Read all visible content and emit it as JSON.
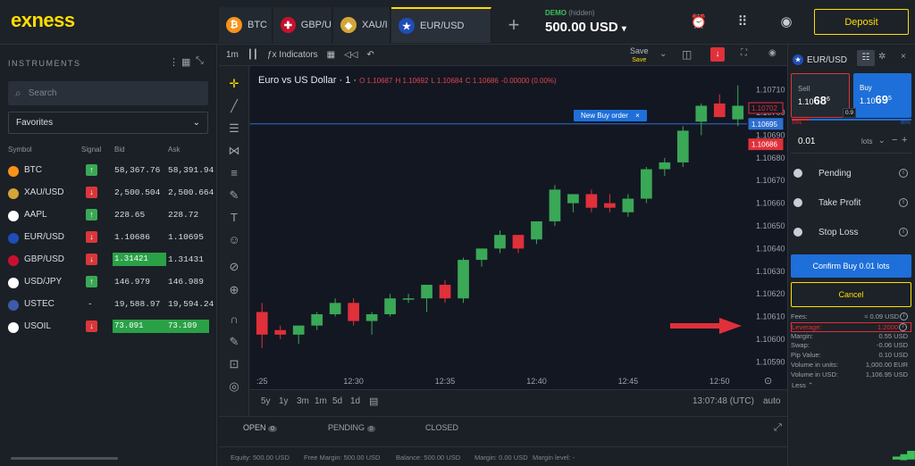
{
  "brand": {
    "logo": "exness",
    "accent": "#ffde02"
  },
  "tabs": [
    {
      "label": "BTC",
      "icon": "btc-coin-icon",
      "color": "#f7931a"
    },
    {
      "label": "GBP/U",
      "icon": "gbp-flag-icon",
      "color": "#c8102e"
    },
    {
      "label": "XAU/I",
      "icon": "gold-icon",
      "color": "#d4a537"
    },
    {
      "label": "EUR/USD",
      "icon": "eur-flag-icon",
      "color": "#1e4db7"
    }
  ],
  "account": {
    "tag": "DEMO",
    "tag_sub": "(hidden)",
    "balance": "500.00 USD"
  },
  "header": {
    "deposit": "Deposit"
  },
  "sidebar": {
    "title": "INSTRUMENTS",
    "search_placeholder": "Search",
    "favorites": "Favorites",
    "col_symbol": "Symbol",
    "col_signal": "Signal",
    "col_bid": "Bid",
    "col_ask": "Ask",
    "rows": [
      {
        "symbol": "BTC",
        "signal": "up",
        "bid": "58,367.76",
        "ask": "58,391.94",
        "icon_color": "#f7931a"
      },
      {
        "symbol": "XAU/USD",
        "signal": "down",
        "bid": "2,500.504",
        "ask": "2,500.664",
        "icon_color": "#d4a537"
      },
      {
        "symbol": "AAPL",
        "signal": "up",
        "bid": "228.65",
        "ask": "228.72",
        "icon_color": "#ffffff"
      },
      {
        "symbol": "EUR/USD",
        "signal": "down",
        "bid": "1.10686",
        "ask": "1.10695",
        "icon_color": "#1e4db7"
      },
      {
        "symbol": "GBP/USD",
        "signal": "down",
        "bid": "1.31421",
        "ask": "1.31431",
        "icon_color": "#c8102e",
        "bid_hl": true
      },
      {
        "symbol": "USD/JPY",
        "signal": "up",
        "bid": "146.979",
        "ask": "146.989",
        "icon_color": "#ffffff"
      },
      {
        "symbol": "USTEC",
        "signal": "-",
        "bid": "19,588.97",
        "ask": "19,594.24",
        "icon_color": "#3c5ba9"
      },
      {
        "symbol": "USOIL",
        "signal": "down",
        "bid": "73.091",
        "ask": "73.109",
        "icon_color": "#ffffff",
        "bid_hl": true,
        "ask_hl": true
      }
    ]
  },
  "toolbar": {
    "interval": "1m",
    "indicators": "Indicators",
    "save": "Save",
    "save_sub": "Save"
  },
  "chart_info": {
    "title": "Euro vs US Dollar · 1 ·",
    "o": "O 1.10687",
    "h": "H 1.10692",
    "l": "L 1.10684",
    "c": "C 1.10686",
    "chg": "-0.00000 (0.00%)"
  },
  "order_label": "New Buy order",
  "price_tags": {
    "sell": "1.10702",
    "line": "1.10695",
    "bid": "1.10686"
  },
  "range_buttons": [
    "5y",
    "1y",
    "3m",
    "1m",
    "5d",
    "1d"
  ],
  "chart_footer": {
    "time": "13:07:48 (UTC)",
    "mode": "auto"
  },
  "bottom_tabs": {
    "open": "OPEN",
    "open_count": "0",
    "pending": "PENDING",
    "pending_count": "0",
    "closed": "CLOSED"
  },
  "status_bar": {
    "equity": "Equity: 500.00 USD",
    "free": "Free Margin: 500.00 USD",
    "balance": "Balance: 500.00 USD",
    "margin": "Margin: 0.00 USD",
    "level": "Margin level: -"
  },
  "panel": {
    "symbol": "EUR/USD",
    "sell_label": "Sell",
    "sell_price_a": "1.10",
    "sell_price_b": "68",
    "sell_price_c": "6",
    "buy_label": "Buy",
    "buy_price_a": "1.10",
    "buy_price_b": "69",
    "buy_price_c": "5",
    "spread": "0.9",
    "pct_left": "15%",
    "pct_right": "85%",
    "lots_value": "0.01",
    "lots_unit": "lots",
    "pending": "Pending",
    "take_profit": "Take Profit",
    "stop_loss": "Stop Loss",
    "confirm": "Confirm Buy 0.01 lots",
    "cancel": "Cancel",
    "fees": [
      {
        "label": "Fees:",
        "value": "≈ 0.09 USD"
      },
      {
        "label": "Leverage:",
        "value": "1:2000"
      },
      {
        "label": "Margin:",
        "value": "0.55 USD"
      },
      {
        "label": "Swap:",
        "value": "-0.06 USD"
      },
      {
        "label": "Pip Value:",
        "value": "0.10 USD"
      },
      {
        "label": "Volume in units:",
        "value": "1,000.00 EUR"
      },
      {
        "label": "Volume in USD:",
        "value": "1,106.95 USD"
      }
    ],
    "less": "Less"
  },
  "chart_data": {
    "type": "candlestick",
    "ylim": [
      1.10585,
      1.10715
    ],
    "y_ticks": [
      "1.10710",
      "1.10700",
      "1.10690",
      "1.10680",
      "1.10670",
      "1.10660",
      "1.10650",
      "1.10640",
      "1.10630",
      "1.10620",
      "1.10610",
      "1.10600",
      "1.10590"
    ],
    "x_ticks": [
      {
        "label": ":25",
        "i": 0
      },
      {
        "label": "12:30",
        "i": 5
      },
      {
        "label": "12:35",
        "i": 10
      },
      {
        "label": "12:40",
        "i": 15
      },
      {
        "label": "12:45",
        "i": 20
      },
      {
        "label": "12:50",
        "i": 25
      }
    ],
    "candles": [
      {
        "o": 1.10612,
        "h": 1.10616,
        "l": 1.10596,
        "c": 1.10602
      },
      {
        "o": 1.10604,
        "h": 1.10606,
        "l": 1.106,
        "c": 1.10602
      },
      {
        "o": 1.10602,
        "h": 1.10606,
        "l": 1.10598,
        "c": 1.10606
      },
      {
        "o": 1.10606,
        "h": 1.10612,
        "l": 1.10604,
        "c": 1.10611
      },
      {
        "o": 1.10611,
        "h": 1.10618,
        "l": 1.1061,
        "c": 1.10616
      },
      {
        "o": 1.10616,
        "h": 1.10618,
        "l": 1.10606,
        "c": 1.10608
      },
      {
        "o": 1.10608,
        "h": 1.10612,
        "l": 1.10602,
        "c": 1.10611
      },
      {
        "o": 1.10611,
        "h": 1.1062,
        "l": 1.1061,
        "c": 1.10618
      },
      {
        "o": 1.10618,
        "h": 1.1062,
        "l": 1.10616,
        "c": 1.10618
      },
      {
        "o": 1.10618,
        "h": 1.10624,
        "l": 1.10612,
        "c": 1.10624
      },
      {
        "o": 1.10624,
        "h": 1.10626,
        "l": 1.10616,
        "c": 1.10618
      },
      {
        "o": 1.10618,
        "h": 1.10636,
        "l": 1.10616,
        "c": 1.10635
      },
      {
        "o": 1.10635,
        "h": 1.1064,
        "l": 1.10632,
        "c": 1.1064
      },
      {
        "o": 1.1064,
        "h": 1.10648,
        "l": 1.10638,
        "c": 1.10646
      },
      {
        "o": 1.10646,
        "h": 1.10644,
        "l": 1.10638,
        "c": 1.1064
      },
      {
        "o": 1.10644,
        "h": 1.10652,
        "l": 1.10642,
        "c": 1.10652
      },
      {
        "o": 1.10652,
        "h": 1.10668,
        "l": 1.1065,
        "c": 1.10666
      },
      {
        "o": 1.1066,
        "h": 1.10664,
        "l": 1.10656,
        "c": 1.10664
      },
      {
        "o": 1.10664,
        "h": 1.10666,
        "l": 1.10656,
        "c": 1.10658
      },
      {
        "o": 1.1066,
        "h": 1.10664,
        "l": 1.10656,
        "c": 1.10658
      },
      {
        "o": 1.10656,
        "h": 1.10664,
        "l": 1.10654,
        "c": 1.10662
      },
      {
        "o": 1.10662,
        "h": 1.10676,
        "l": 1.1066,
        "c": 1.10675
      },
      {
        "o": 1.10675,
        "h": 1.1068,
        "l": 1.10672,
        "c": 1.10678
      },
      {
        "o": 1.10678,
        "h": 1.10694,
        "l": 1.10676,
        "c": 1.10692
      },
      {
        "o": 1.10696,
        "h": 1.10704,
        "l": 1.1069,
        "c": 1.10703
      },
      {
        "o": 1.10704,
        "h": 1.10708,
        "l": 1.10698,
        "c": 1.10698
      },
      {
        "o": 1.10697,
        "h": 1.10712,
        "l": 1.10694,
        "c": 1.10703
      }
    ],
    "up_color": "#3aa856",
    "down_color": "#e0303a",
    "horizontal_line": 1.10695
  }
}
